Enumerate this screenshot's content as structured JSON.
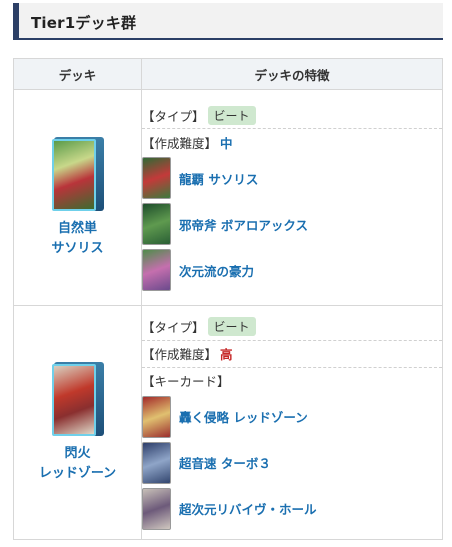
{
  "heading": {
    "title": "Tier1デッキ群"
  },
  "colors": {
    "accent": "#2c3f66",
    "link": "#1a6fb0",
    "tag_bg": "#cfe8cf",
    "high": "#c62828"
  },
  "table": {
    "headers": {
      "deck": "デッキ",
      "feature": "デッキの特徴"
    },
    "rows": [
      {
        "deck_name_line1": "自然単",
        "deck_name_line2": "サソリス",
        "type_label": "【タイプ】",
        "type_value": "ビート",
        "difficulty_label": "【作成難度】",
        "difficulty_value": "中",
        "cards": [
          "龍覇 サソリス",
          "邪帝斧 ボアロアックス",
          "次元流の豪力"
        ]
      },
      {
        "deck_name_line1": "閃火",
        "deck_name_line2": "レッドゾーン",
        "type_label": "【タイプ】",
        "type_value": "ビート",
        "difficulty_label": "【作成難度】",
        "difficulty_value": "高",
        "keycard_label": "【キーカード】",
        "cards": [
          "轟く侵略 レッドゾーン",
          "超音速 ターボ３",
          "超次元リバイヴ・ホール"
        ]
      }
    ]
  }
}
